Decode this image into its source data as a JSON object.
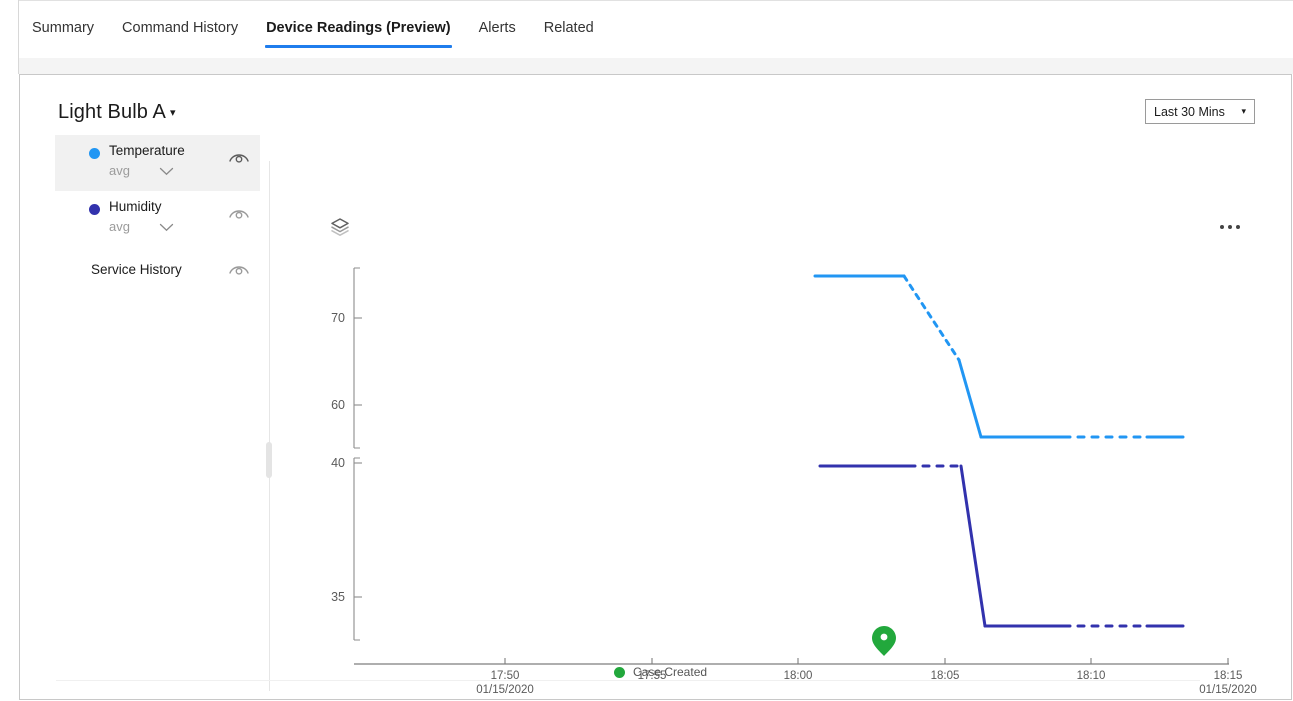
{
  "tabs": [
    {
      "label": "Summary",
      "active": false
    },
    {
      "label": "Command History",
      "active": false
    },
    {
      "label": "Device Readings (Preview)",
      "active": true
    },
    {
      "label": "Alerts",
      "active": false
    },
    {
      "label": "Related",
      "active": false
    }
  ],
  "header": {
    "device_title": "Light Bulb A",
    "device_caret": "▾",
    "time_range_label": "Last 30 Mins",
    "time_range_caret": "▾",
    "more_icon": "ellipsis-icon",
    "layers_icon": "layers-icon"
  },
  "legend": {
    "items": [
      {
        "name": "Temperature",
        "aggregation": "avg",
        "color": "#2196f3",
        "selected": true,
        "has_dot": true,
        "eye_icon": "eye-icon"
      },
      {
        "name": "Humidity",
        "aggregation": "avg",
        "color": "#3232ad",
        "selected": false,
        "has_dot": true,
        "eye_icon": "eye-icon"
      },
      {
        "name": "Service History",
        "aggregation": "",
        "color": "",
        "selected": false,
        "has_dot": false,
        "eye_icon": "eye-icon"
      }
    ]
  },
  "event_legend": {
    "label": "Case Created",
    "color": "#22a83c"
  },
  "chart_data": {
    "type": "line",
    "title": "",
    "xlabel": "",
    "ylabel": "",
    "grid": false,
    "legend_position": "left",
    "x_axis": {
      "ticks": [
        "17:50",
        "17:55",
        "18:00",
        "18:05",
        "18:10",
        "18:15"
      ],
      "date_first": "01/15/2020",
      "date_last": "01/15/2020",
      "range": [
        "17:47",
        "18:15"
      ]
    },
    "panels": [
      {
        "name": "Temperature",
        "color": "#2196f3",
        "y_ticks": [
          70,
          60
        ],
        "ylim": [
          55,
          78
        ]
      },
      {
        "name": "Humidity",
        "color": "#3232ad",
        "y_ticks": [
          40,
          35
        ],
        "ylim": [
          32.5,
          40.8
        ]
      }
    ],
    "series": [
      {
        "name": "Temperature",
        "color": "#2196f3",
        "unit": "",
        "points": [
          {
            "t": "18:01",
            "y": 75.5,
            "style": "solid"
          },
          {
            "t": "18:03:30",
            "y": 75.5,
            "style": "solid"
          },
          {
            "t": "18:06:20",
            "y": 65.5,
            "style": "dashed"
          },
          {
            "t": "18:07:10",
            "y": 55.5,
            "style": "solid"
          },
          {
            "t": "18:09:15",
            "y": 55.5,
            "style": "solid"
          },
          {
            "t": "18:11:30",
            "y": 55.5,
            "style": "dashed"
          },
          {
            "t": "18:15",
            "y": 55.5,
            "style": "solid"
          }
        ]
      },
      {
        "name": "Humidity",
        "color": "#3232ad",
        "unit": "",
        "points": [
          {
            "t": "18:01:20",
            "y": 40.1,
            "style": "solid"
          },
          {
            "t": "18:04:10",
            "y": 40.1,
            "style": "dashed"
          },
          {
            "t": "18:06:25",
            "y": 40.1,
            "style": "solid"
          },
          {
            "t": "18:07:15",
            "y": 33.6,
            "style": "solid"
          },
          {
            "t": "18:09:15",
            "y": 33.6,
            "style": "solid"
          },
          {
            "t": "18:11:30",
            "y": 33.6,
            "style": "dashed"
          },
          {
            "t": "18:15",
            "y": 33.6,
            "style": "solid"
          }
        ]
      }
    ],
    "events": [
      {
        "label": "Case Created",
        "t": "18:04:20",
        "color": "#22a83c",
        "marker": "map-pin"
      }
    ]
  }
}
